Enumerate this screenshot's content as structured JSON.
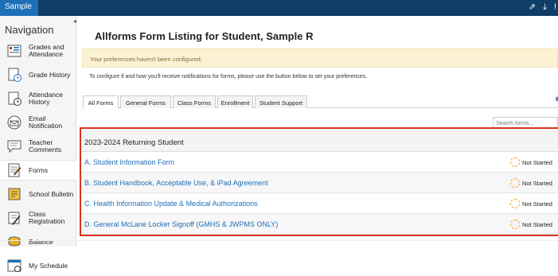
{
  "header": {
    "user_tab": "Sample",
    "icons": [
      "external-link-icon",
      "download-icon",
      "alert-icon"
    ]
  },
  "sidebar": {
    "title": "Navigation",
    "items": [
      {
        "label": "Grades and Attendance",
        "icon": "grades-icon"
      },
      {
        "label": "Grade History",
        "icon": "grade-history-icon"
      },
      {
        "label": "Attendance History",
        "icon": "attendance-history-icon"
      },
      {
        "label": "Email Notification",
        "icon": "email-icon"
      },
      {
        "label": "Teacher Comments",
        "icon": "comments-icon"
      },
      {
        "label": "Forms",
        "icon": "forms-icon",
        "active": true
      },
      {
        "label": "School Bulletin",
        "icon": "bulletin-icon"
      },
      {
        "label": "Class Registration",
        "icon": "registration-icon"
      },
      {
        "label": "Balance",
        "icon": "balance-icon"
      },
      {
        "label": "My Schedule",
        "icon": "schedule-icon"
      }
    ]
  },
  "main": {
    "title": "Allforms Form Listing for Student, Sample R",
    "alert": "Your preferences haven't been configured.",
    "info": "To configure if and how you'll receive notifications for forms, please use the button below to set your preferences.",
    "tabs": [
      "All Forms",
      "General Forms",
      "Class Forms",
      "Enrollment",
      "Student Support"
    ],
    "active_tab": "All Forms",
    "search_placeholder": "Search forms...",
    "group_title": "2023-2024 Returning Student",
    "forms": [
      {
        "name": "A. Student Information Form",
        "status": "Not Started"
      },
      {
        "name": "B. Student Handbook, Acceptable Use, & iPad Agreement",
        "status": "Not Started"
      },
      {
        "name": "C. Health Information Update & Medical Authorizations",
        "status": "Not Started"
      },
      {
        "name": "D. General McLane Locker Signoff (GMHS & JWPMS ONLY)",
        "status": "Not Started"
      }
    ]
  },
  "colors": {
    "header_bg": "#0e3d66",
    "link": "#1e6fb8",
    "highlight_border": "#d9341f",
    "alert_bg": "#faf2d3",
    "status_icon": "#f0a040"
  }
}
